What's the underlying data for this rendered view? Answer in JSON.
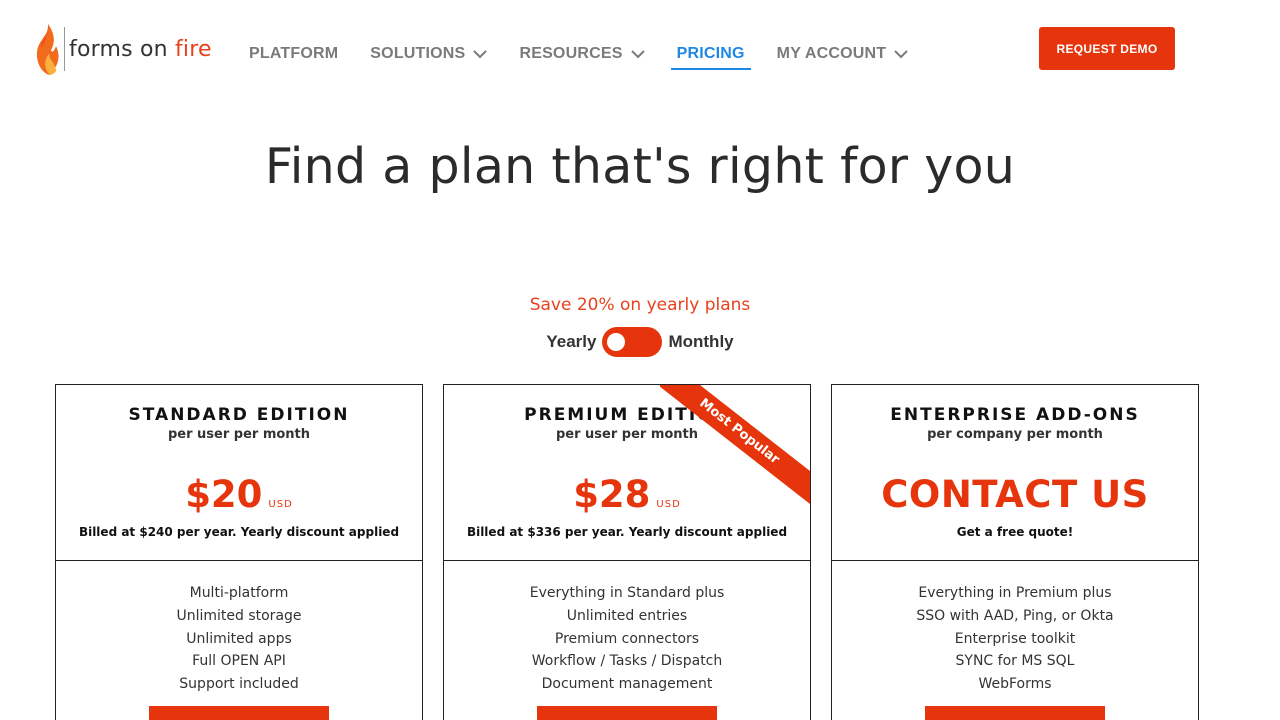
{
  "brand": {
    "name_part1": "forms on",
    "name_part2": "fire",
    "accent_color": "#e6350c",
    "link_color": "#1e88e5"
  },
  "nav": {
    "items": [
      {
        "label": "PLATFORM",
        "has_dropdown": false
      },
      {
        "label": "SOLUTIONS",
        "has_dropdown": true
      },
      {
        "label": "RESOURCES",
        "has_dropdown": true
      },
      {
        "label": "PRICING",
        "has_dropdown": false,
        "active": true
      },
      {
        "label": "MY ACCOUNT",
        "has_dropdown": true
      }
    ],
    "cta_label": "REQUEST DEMO"
  },
  "hero": {
    "title": "Find a plan that's right for you"
  },
  "billing": {
    "save_text": "Save 20% on yearly plans",
    "yearly_label": "Yearly",
    "monthly_label": "Monthly",
    "selected": "Yearly"
  },
  "plans": [
    {
      "title": "STANDARD EDITION",
      "subtitle": "per user per month",
      "price": "$20",
      "currency": "USD",
      "billed": "Billed at $240 per year. Yearly discount applied",
      "features": [
        "Multi-platform",
        "Unlimited storage",
        "Unlimited apps",
        "Full OPEN API",
        "Support included"
      ]
    },
    {
      "title": "PREMIUM EDITION",
      "subtitle": "per user per month",
      "price": "$28",
      "currency": "USD",
      "billed": "Billed at $336 per year. Yearly discount applied",
      "ribbon": "Most Popular",
      "features": [
        "Everything in Standard plus",
        "Unlimited entries",
        "Premium connectors",
        "Workflow / Tasks / Dispatch",
        "Document management"
      ]
    },
    {
      "title": "ENTERPRISE ADD-ONS",
      "subtitle": "per company per month",
      "price_text": "CONTACT US",
      "billed": "Get a free quote!",
      "features": [
        "Everything in Premium plus",
        "SSO with AAD, Ping, or Okta",
        "Enterprise toolkit",
        "SYNC for MS SQL",
        "WebForms"
      ]
    }
  ]
}
